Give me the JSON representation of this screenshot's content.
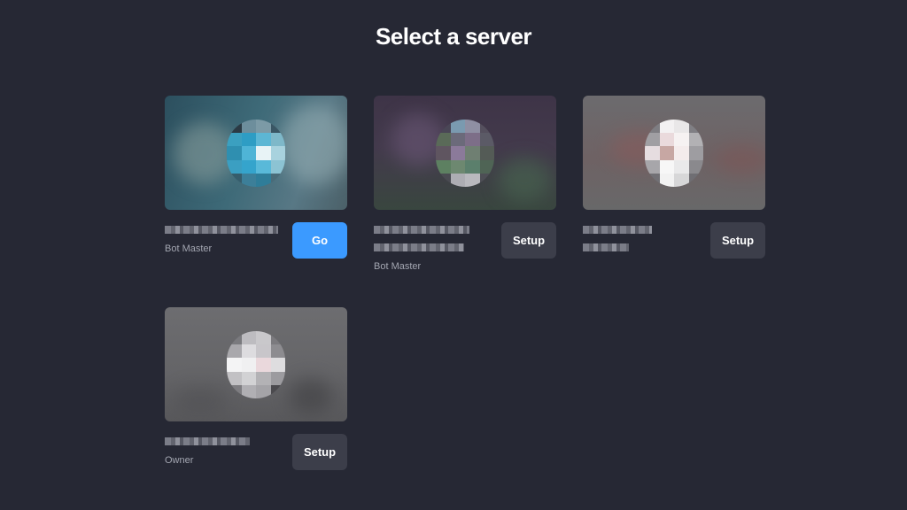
{
  "page": {
    "title": "Select a server"
  },
  "servers": [
    {
      "role": "Bot Master",
      "button_label": "Go",
      "button_style": "primary",
      "theme": "teal",
      "redacted_name": true
    },
    {
      "role": "Bot Master",
      "button_label": "Setup",
      "button_style": "secondary",
      "theme": "purple",
      "redacted_name": true
    },
    {
      "role": "",
      "button_label": "Setup",
      "button_style": "secondary",
      "theme": "grey-red",
      "redacted_name": true
    },
    {
      "role": "Owner",
      "button_label": "Setup",
      "button_style": "secondary",
      "theme": "grey",
      "redacted_name": true
    }
  ],
  "colors": {
    "background": "#262834",
    "primary_button": "#3b9aff",
    "secondary_button": "#3c3e4a",
    "muted_text": "#a3a6b1"
  }
}
